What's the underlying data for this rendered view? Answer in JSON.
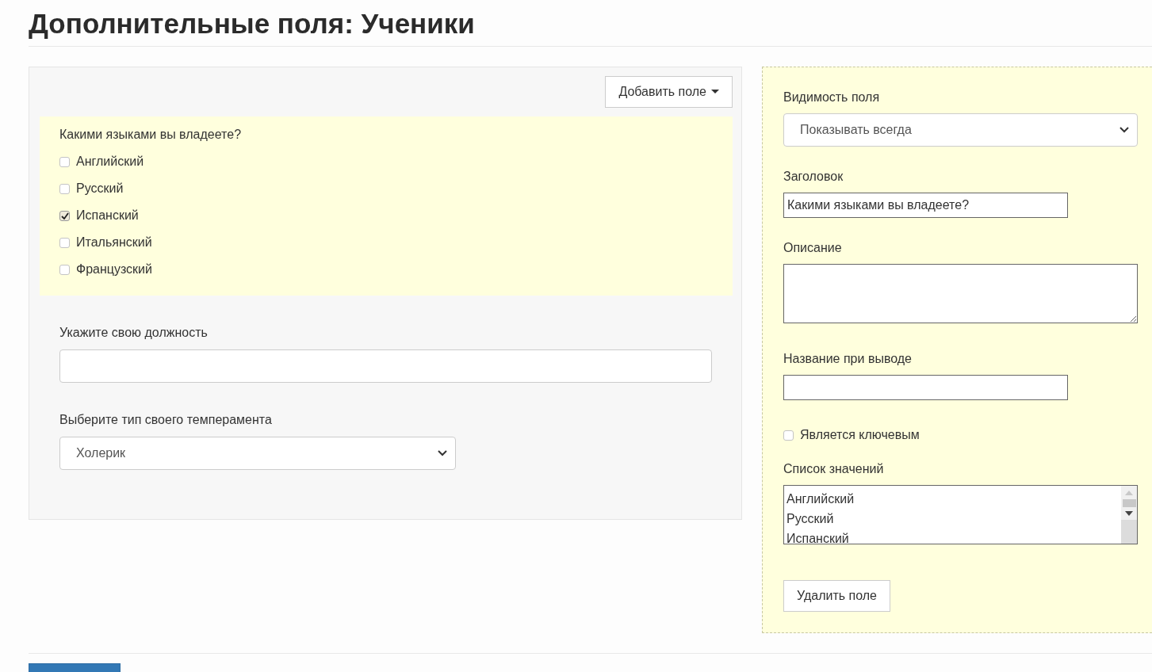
{
  "page_title": "Дополнительные поля: Ученики",
  "add_field_button": "Добавить поле",
  "preview_fields": [
    {
      "kind": "checkbox_group",
      "selected": true,
      "label": "Какими языками вы владеете?",
      "options": [
        {
          "label": "Английский",
          "checked": false
        },
        {
          "label": "Русский",
          "checked": false
        },
        {
          "label": "Испанский",
          "checked": true
        },
        {
          "label": "Итальянский",
          "checked": false
        },
        {
          "label": "Французский",
          "checked": false
        }
      ]
    },
    {
      "kind": "text",
      "selected": false,
      "label": "Укажите свою должность"
    },
    {
      "kind": "select",
      "selected": false,
      "label": "Выберите тип своего темперамента",
      "value": "Холерик"
    }
  ],
  "settings": {
    "visibility": {
      "label": "Видимость поля",
      "value": "Показывать всегда"
    },
    "title": {
      "label": "Заголовок",
      "value": "Какими языками вы владеете?"
    },
    "description": {
      "label": "Описание"
    },
    "output_name": {
      "label": "Название при выводе"
    },
    "is_key": {
      "label": "Является ключевым",
      "checked": false
    },
    "values_list": {
      "label": "Список значений",
      "values": [
        "Английский",
        "Русский",
        "Испанский"
      ]
    },
    "delete_button": "Удалить поле"
  }
}
